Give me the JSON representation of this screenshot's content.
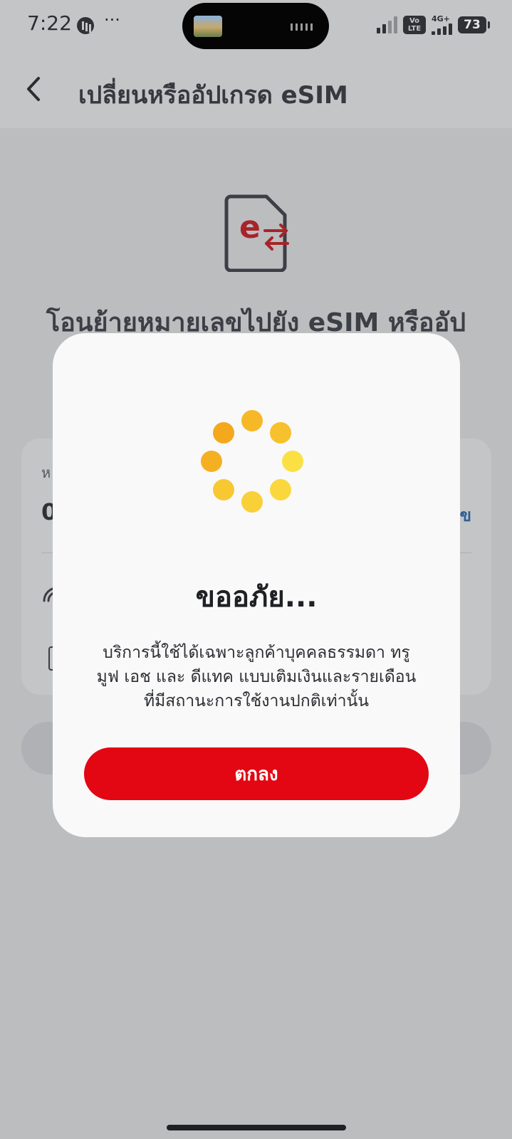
{
  "status_bar": {
    "time": "7:22",
    "more": "···",
    "volte": "Vo\nLTE",
    "network": "4G+",
    "battery": "73"
  },
  "header": {
    "back_icon": "chevron-left-icon",
    "title": "เปลี่ยนหรืออัปเกรด eSIM"
  },
  "page": {
    "heading": "โอนย้ายหมายเลขไปยัง eSIM หรืออัป",
    "card_label": "ห",
    "card_number": "0",
    "card_link": "ข"
  },
  "dialog": {
    "title": "ขออภัย...",
    "message_lines": [
      "บริการนี้ใช้ได้เฉพาะลูกค้าบุคคลธรรมดา ทรู",
      "มูฟ เอช และ ดีแทค แบบเติมเงินและรายเดือน",
      "ที่มีสถานะการใช้งานปกติเท่านั้น"
    ],
    "ok_label": "ตกลง"
  },
  "colors": {
    "brand_red": "#e30613",
    "spinner_dark": "#f4a81c",
    "spinner_light": "#fbe043",
    "overlay_gray": "#bcbdbf"
  }
}
